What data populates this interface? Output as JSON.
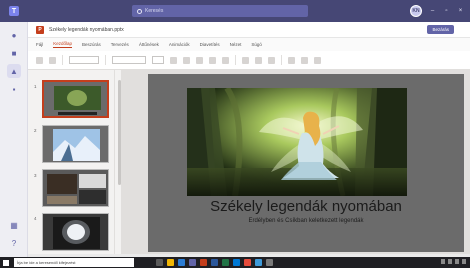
{
  "teams": {
    "search_placeholder": "Keresés",
    "avatar_initials": "KN"
  },
  "document": {
    "title": "Székely legendák nyomában.pptx",
    "close_label": "Bezárás"
  },
  "menu": {
    "tabs": [
      "Fájl",
      "Kezdőlap",
      "Beszúrás",
      "Tervezés",
      "Áttűnések",
      "Animációk",
      "Diavetítés",
      "Nézet",
      "Súgó"
    ],
    "active_index": 1
  },
  "thumbnails": [
    {
      "number": "1"
    },
    {
      "number": "2"
    },
    {
      "number": "3"
    },
    {
      "number": "4"
    }
  ],
  "slide": {
    "title": "Székely legendák nyomában",
    "subtitle": "Erdélyben és Csíkban keletkezett legendák"
  },
  "taskbar": {
    "search_placeholder": "Írja be ide a keresendő kifejezést"
  },
  "colors": {
    "teams_header": "#464775",
    "accent": "#c43e1c",
    "slide_background": "#6b6b6b"
  }
}
